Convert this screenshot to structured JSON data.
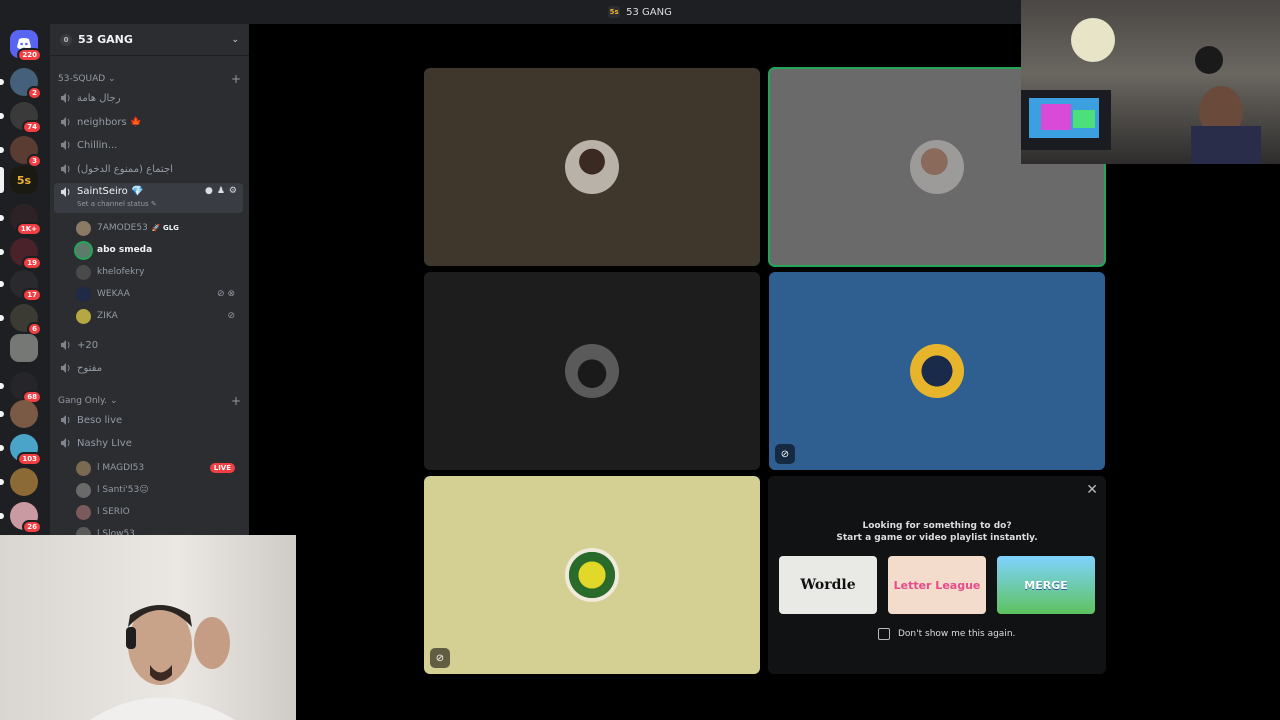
{
  "window": {
    "title": "53 GANG"
  },
  "guild": {
    "name": "53 GANG",
    "icon_text": "5s"
  },
  "servers": [
    {
      "badge": "220"
    },
    {
      "badge": "2"
    },
    {
      "badge": "74"
    },
    {
      "badge": "3"
    },
    {
      "badge": ""
    },
    {
      "badge": "1K+"
    },
    {
      "badge": "19"
    },
    {
      "badge": "17"
    },
    {
      "badge": "6"
    },
    {
      "badge": ""
    },
    {
      "badge": "68"
    },
    {
      "badge": ""
    },
    {
      "badge": "103"
    },
    {
      "badge": ""
    },
    {
      "badge": "26"
    }
  ],
  "sidebar": {
    "cat1": {
      "label": "53-SQUAD"
    },
    "cat2": {
      "label": "Gang Only."
    },
    "channels": [
      {
        "label": "رجال هامة"
      },
      {
        "label": "neighbors 🍁"
      },
      {
        "label": "Chillin..."
      },
      {
        "label": "اجتماع (ممنوع الدخول)"
      },
      {
        "label": "SaintSeiro 💎",
        "status": "Set a channel status ✎"
      },
      {
        "label": "+20"
      },
      {
        "label": "مفتوح"
      },
      {
        "label": "Beso live"
      },
      {
        "label": "Nashy LIve"
      }
    ],
    "voice_users": [
      {
        "name": "7AMODE53",
        "tag": "🚀 GLG"
      },
      {
        "name": "abo smeda"
      },
      {
        "name": "khelofekry"
      },
      {
        "name": "WEKAA"
      },
      {
        "name": "ZIKA"
      }
    ],
    "nashy_users": [
      {
        "name": "l MAGDI53",
        "live": "LIVE"
      },
      {
        "name": "l Santi'53😐"
      },
      {
        "name": "l SERIO"
      },
      {
        "name": "l Slow53"
      }
    ]
  },
  "activity": {
    "title_line1": "Looking for something to do?",
    "title_line2": "Start a game or video playlist instantly.",
    "games": [
      "Wordle",
      "Letter League",
      "MERGE"
    ],
    "dont_show": "Don't show me this again."
  },
  "colors": {
    "speaking_outline": "#23a55a",
    "live_badge": "#f23f43",
    "tile_brown": "#3f372c",
    "tile_gray": "#6b6a6b",
    "tile_dark": "#1d1d1e",
    "tile_blue": "#2f5e91",
    "tile_yellow": "#d4cf93"
  }
}
